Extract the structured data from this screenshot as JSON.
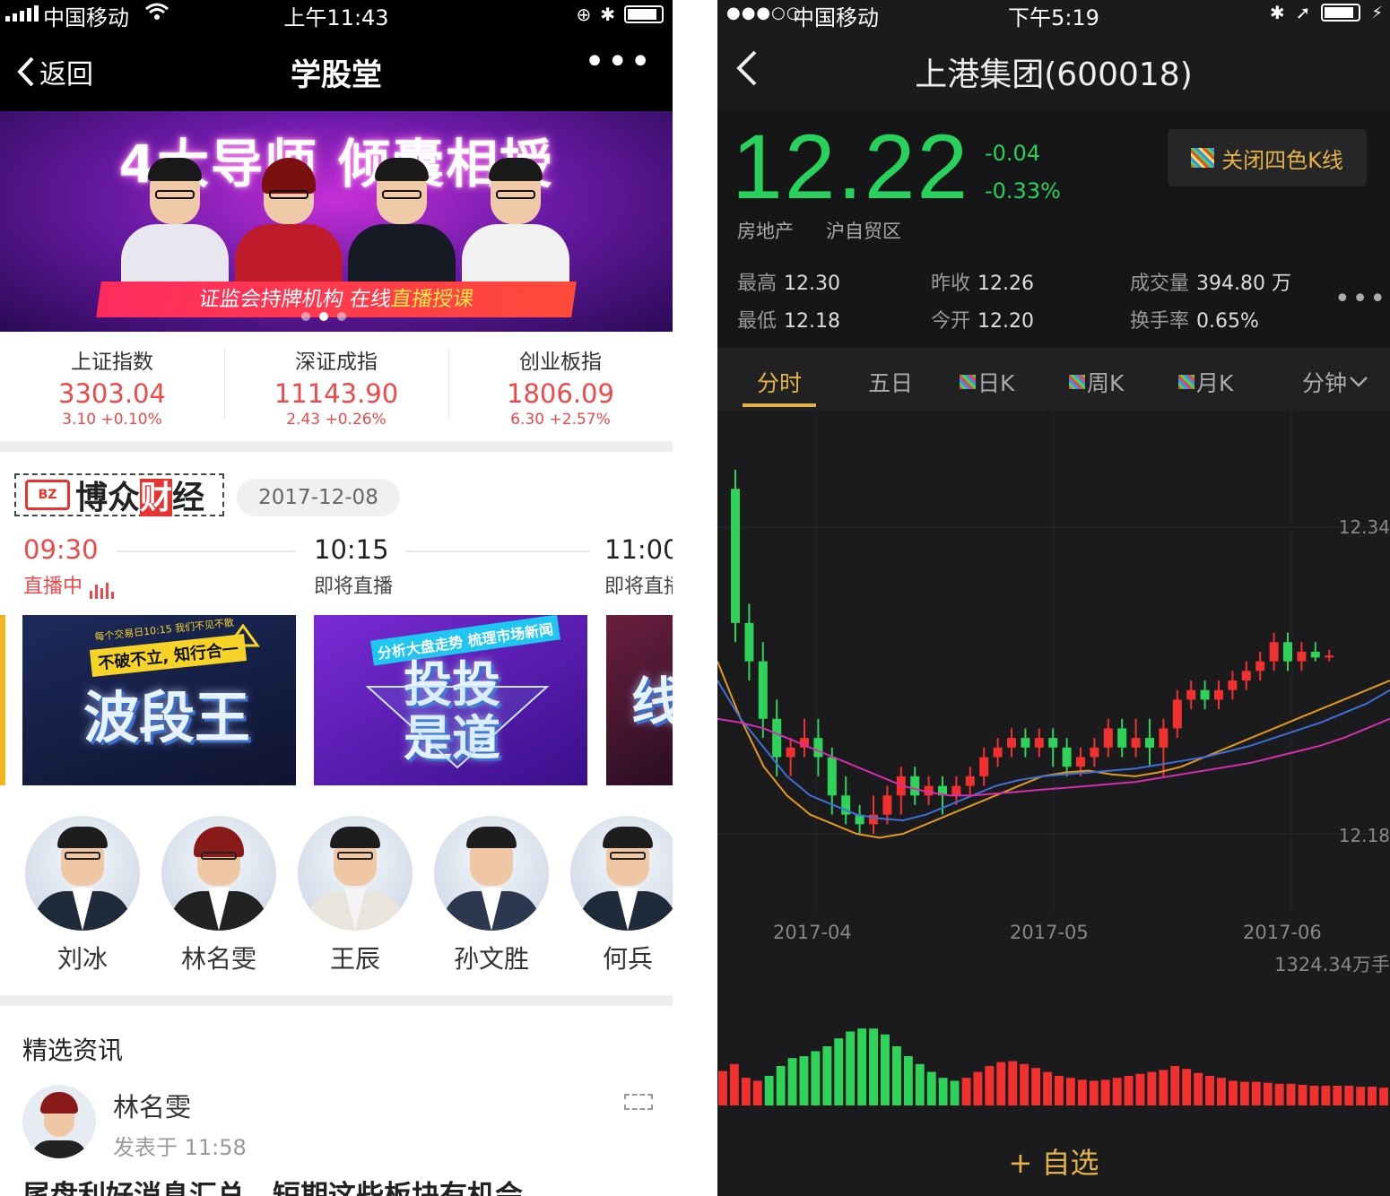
{
  "left": {
    "status": {
      "carrier": "中国移动",
      "time": "上午11:43"
    },
    "nav": {
      "back_label": "返回",
      "title": "学股堂",
      "more": "•••"
    },
    "banner": {
      "headline": "4大导师 倾囊相授",
      "strip_a": "证监会持牌机构  在线",
      "strip_b": "直播授课"
    },
    "indices": [
      {
        "name": "上证指数",
        "value": "3303.04",
        "change": "3.10  +0.10%"
      },
      {
        "name": "深证成指",
        "value": "11143.90",
        "change": "2.43  +0.26%"
      },
      {
        "name": "创业板指",
        "value": "1806.09",
        "change": "6.30  +2.57%"
      }
    ],
    "brand": {
      "logo": "BZ",
      "name_a": "博众",
      "name_b": "财",
      "name_c": "经"
    },
    "date": "2017-12-08",
    "schedule": [
      {
        "time": "09:30",
        "status": "直播中"
      },
      {
        "time": "10:15",
        "status": "即将直播"
      },
      {
        "time": "11:00",
        "status": "即将直播"
      }
    ],
    "thumbs": [
      {
        "big": "波段王",
        "tag": "不破不立, 知行合一",
        "small": "每个交易日10:15 我们不见不散"
      },
      {
        "big": "投投是道",
        "tag": "分析大盘走势  梳理市场新闻"
      },
      {
        "big": "线"
      }
    ],
    "teachers": [
      "刘冰",
      "林名雯",
      "王辰",
      "孙文胜",
      "何兵"
    ],
    "section_title": "精选资讯",
    "post": {
      "author": "林名雯",
      "time": "发表于 11:58",
      "headline": "尾盘利好消息汇总，短期这些板块有机会"
    }
  },
  "right": {
    "status": {
      "dots": "●●●○○",
      "carrier": "中国移动",
      "time": "下午5:19"
    },
    "nav": {
      "title": "上港集团(600018)"
    },
    "price": "12.22",
    "change_abs": "-0.04",
    "change_pct": "-0.33%",
    "k4_button": "关闭四色K线",
    "tags": [
      "房地产",
      "沪自贸区"
    ],
    "stats": {
      "high_label": "最高",
      "high": "12.30",
      "low_label": "最低",
      "low": "12.18",
      "prev_label": "昨收",
      "prev": "12.26",
      "open_label": "今开",
      "open": "12.20",
      "vol_label": "成交量",
      "vol": "394.80 万",
      "turn_label": "换手率",
      "turn": "0.65%"
    },
    "more": "•••",
    "tabs": [
      "分时",
      "五日",
      "日K",
      "周K",
      "月K",
      "分钟"
    ],
    "add_watch": "+ 自选",
    "colors": {
      "up": "#f23030",
      "down": "#2fd35a",
      "accent": "#e4b347"
    }
  },
  "chart_data": {
    "type": "candlestick",
    "y_labels": [
      "12.34",
      "12.18"
    ],
    "x_labels": [
      "2017-04",
      "2017-05",
      "2017-06"
    ],
    "volume_label": "1324.34万手",
    "candles": [
      [
        12.36,
        12.29,
        12.37,
        12.28
      ],
      [
        12.29,
        12.27,
        12.3,
        12.26
      ],
      [
        12.27,
        12.24,
        12.28,
        12.23
      ],
      [
        12.24,
        12.22,
        12.25,
        12.21
      ],
      [
        12.22,
        12.225,
        12.23,
        12.21
      ],
      [
        12.225,
        12.23,
        12.24,
        12.22
      ],
      [
        12.23,
        12.22,
        12.24,
        12.21
      ],
      [
        12.22,
        12.2,
        12.225,
        12.19
      ],
      [
        12.2,
        12.19,
        12.21,
        12.185
      ],
      [
        12.19,
        12.185,
        12.195,
        12.18
      ],
      [
        12.185,
        12.19,
        12.2,
        12.18
      ],
      [
        12.19,
        12.2,
        12.205,
        12.185
      ],
      [
        12.2,
        12.21,
        12.215,
        12.19
      ],
      [
        12.21,
        12.2,
        12.215,
        12.195
      ],
      [
        12.2,
        12.205,
        12.21,
        12.195
      ],
      [
        12.205,
        12.2,
        12.21,
        12.19
      ],
      [
        12.2,
        12.205,
        12.21,
        12.195
      ],
      [
        12.205,
        12.21,
        12.215,
        12.2
      ],
      [
        12.21,
        12.22,
        12.225,
        12.205
      ],
      [
        12.22,
        12.225,
        12.23,
        12.215
      ],
      [
        12.225,
        12.23,
        12.235,
        12.22
      ],
      [
        12.23,
        12.225,
        12.235,
        12.22
      ],
      [
        12.225,
        12.23,
        12.235,
        12.22
      ],
      [
        12.23,
        12.225,
        12.235,
        12.215
      ],
      [
        12.225,
        12.215,
        12.23,
        12.21
      ],
      [
        12.215,
        12.22,
        12.225,
        12.21
      ],
      [
        12.22,
        12.225,
        12.23,
        12.215
      ],
      [
        12.225,
        12.235,
        12.24,
        12.22
      ],
      [
        12.235,
        12.225,
        12.24,
        12.22
      ],
      [
        12.225,
        12.23,
        12.24,
        12.22
      ],
      [
        12.23,
        12.225,
        12.24,
        12.215
      ],
      [
        12.225,
        12.235,
        12.24,
        12.21
      ],
      [
        12.235,
        12.25,
        12.255,
        12.23
      ],
      [
        12.25,
        12.255,
        12.26,
        12.245
      ],
      [
        12.255,
        12.25,
        12.26,
        12.245
      ],
      [
        12.25,
        12.255,
        12.26,
        12.245
      ],
      [
        12.255,
        12.26,
        12.265,
        12.25
      ],
      [
        12.26,
        12.265,
        12.27,
        12.255
      ],
      [
        12.265,
        12.27,
        12.275,
        12.26
      ],
      [
        12.27,
        12.28,
        12.285,
        12.265
      ],
      [
        12.28,
        12.27,
        12.285,
        12.265
      ],
      [
        12.27,
        12.275,
        12.28,
        12.265
      ],
      [
        12.275,
        12.272,
        12.28,
        12.27
      ],
      [
        12.272,
        12.273,
        12.276,
        12.27
      ]
    ],
    "ma": [
      {
        "name": "orange",
        "color": "#e39a1e",
        "values": [
          12.27,
          12.24,
          12.215,
          12.2,
          12.19,
          12.185,
          12.18,
          12.178,
          12.18,
          12.185,
          12.19,
          12.195,
          12.2,
          12.205,
          12.21,
          12.212,
          12.213,
          12.211,
          12.21,
          12.212,
          12.215,
          12.22,
          12.225,
          12.23,
          12.235,
          12.24,
          12.245,
          12.25,
          12.255,
          12.26
        ]
      },
      {
        "name": "blue",
        "color": "#3f6fd6",
        "values": [
          12.26,
          12.24,
          12.225,
          12.21,
          12.2,
          12.195,
          12.19,
          12.188,
          12.187,
          12.19,
          12.195,
          12.2,
          12.205,
          12.208,
          12.21,
          12.211,
          12.212,
          12.213,
          12.214,
          12.216,
          12.218,
          12.22,
          12.223,
          12.226,
          12.23,
          12.234,
          12.238,
          12.243,
          12.248,
          12.255
        ]
      },
      {
        "name": "magenta",
        "color": "#d42fae",
        "values": [
          12.24,
          12.238,
          12.235,
          12.23,
          12.225,
          12.22,
          12.215,
          12.21,
          12.205,
          12.202,
          12.2,
          12.2,
          12.201,
          12.202,
          12.203,
          12.204,
          12.205,
          12.206,
          12.207,
          12.209,
          12.211,
          12.213,
          12.215,
          12.217,
          12.22,
          12.223,
          12.226,
          12.23,
          12.235,
          12.24
        ]
      }
    ],
    "volume": [
      [
        "u",
        0.35
      ],
      [
        "u",
        0.42
      ],
      [
        "u",
        0.28
      ],
      [
        "u",
        0.25
      ],
      [
        "d",
        0.3
      ],
      [
        "d",
        0.4
      ],
      [
        "d",
        0.48
      ],
      [
        "d",
        0.5
      ],
      [
        "d",
        0.55
      ],
      [
        "d",
        0.6
      ],
      [
        "d",
        0.68
      ],
      [
        "d",
        0.75
      ],
      [
        "d",
        0.78
      ],
      [
        "d",
        0.78
      ],
      [
        "d",
        0.72
      ],
      [
        "d",
        0.6
      ],
      [
        "d",
        0.5
      ],
      [
        "d",
        0.42
      ],
      [
        "d",
        0.34
      ],
      [
        "d",
        0.28
      ],
      [
        "d",
        0.25
      ],
      [
        "u",
        0.28
      ],
      [
        "u",
        0.34
      ],
      [
        "u",
        0.4
      ],
      [
        "u",
        0.44
      ],
      [
        "u",
        0.45
      ],
      [
        "u",
        0.42
      ],
      [
        "u",
        0.38
      ],
      [
        "u",
        0.34
      ],
      [
        "u",
        0.3
      ],
      [
        "u",
        0.28
      ],
      [
        "u",
        0.26
      ],
      [
        "u",
        0.25
      ],
      [
        "u",
        0.26
      ],
      [
        "u",
        0.28
      ],
      [
        "u",
        0.3
      ],
      [
        "u",
        0.32
      ],
      [
        "u",
        0.34
      ],
      [
        "u",
        0.36
      ],
      [
        "u",
        0.4
      ],
      [
        "u",
        0.37
      ],
      [
        "u",
        0.33
      ],
      [
        "u",
        0.3
      ],
      [
        "u",
        0.28
      ],
      [
        "u",
        0.25
      ],
      [
        "u",
        0.24
      ],
      [
        "u",
        0.24
      ],
      [
        "u",
        0.23
      ],
      [
        "u",
        0.22
      ],
      [
        "u",
        0.22
      ],
      [
        "u",
        0.21
      ],
      [
        "u",
        0.2
      ],
      [
        "u",
        0.2
      ],
      [
        "u",
        0.2
      ],
      [
        "u",
        0.2
      ],
      [
        "u",
        0.19
      ],
      [
        "u",
        0.19
      ],
      [
        "u",
        0.18
      ]
    ]
  }
}
